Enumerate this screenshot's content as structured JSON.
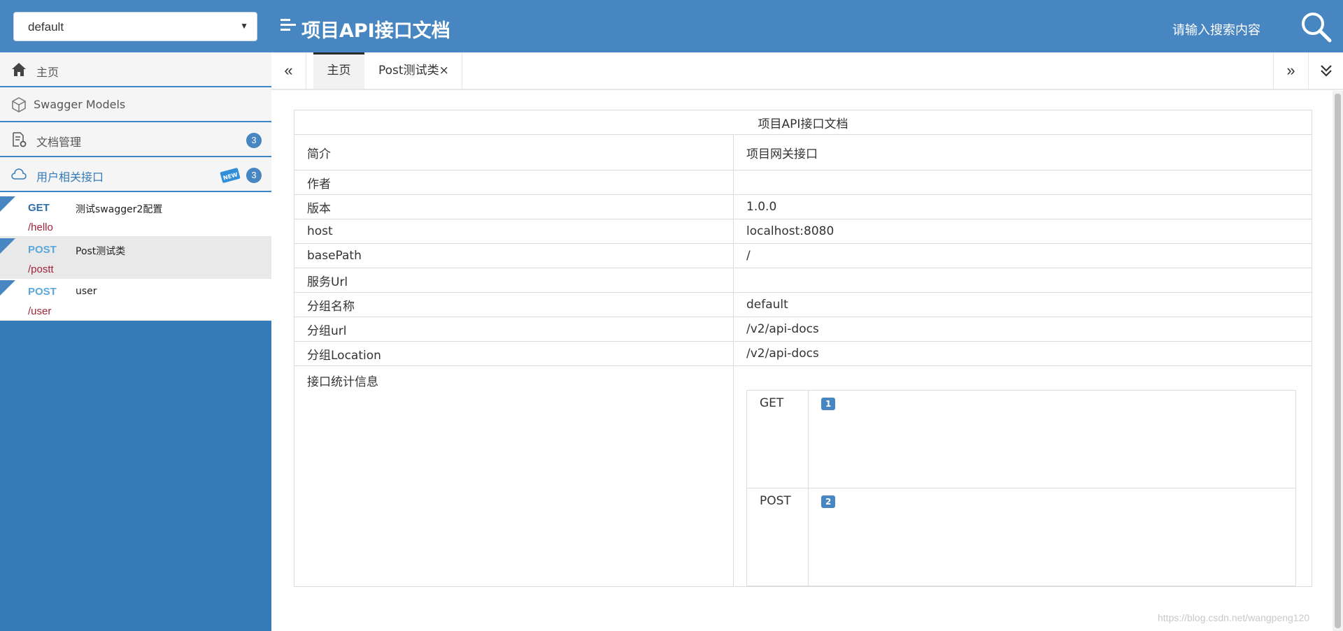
{
  "header": {
    "group_select": "default",
    "title": "项目API接口文档",
    "search_placeholder": "请输入搜索内容"
  },
  "sidebar": {
    "menu": [
      {
        "label": "主页",
        "icon": "home-icon"
      },
      {
        "label": "Swagger Models",
        "icon": "cube-icon"
      },
      {
        "label": "文档管理",
        "icon": "document-settings-icon",
        "badge": "3"
      },
      {
        "label": "用户相关接口",
        "icon": "cloud-api-icon",
        "badge": "3",
        "new": "NEW"
      }
    ],
    "apis": [
      {
        "method": "GET",
        "summary": "测试swagger2配置",
        "path": "/hello"
      },
      {
        "method": "POST",
        "summary": "Post测试类",
        "path": "/postt"
      },
      {
        "method": "POST",
        "summary": "user",
        "path": "/user"
      }
    ]
  },
  "tabs": {
    "prev": "«",
    "next": "»",
    "items": [
      {
        "label": "主页"
      },
      {
        "label": "Post测试类×"
      }
    ]
  },
  "doc": {
    "title": "项目API接口文档",
    "rows": [
      {
        "key": "简介",
        "value": "项目网关接口"
      },
      {
        "key": "作者",
        "value": ""
      },
      {
        "key": "版本",
        "value": "1.0.0"
      },
      {
        "key": "host",
        "value": "localhost:8080"
      },
      {
        "key": "basePath",
        "value": "/"
      },
      {
        "key": "服务Url",
        "value": ""
      },
      {
        "key": "分组名称",
        "value": "default"
      },
      {
        "key": "分组url",
        "value": "/v2/api-docs"
      },
      {
        "key": "分组Location",
        "value": "/v2/api-docs"
      }
    ],
    "stats_label": "接口统计信息",
    "stats": [
      {
        "method": "GET",
        "count": "1"
      },
      {
        "method": "POST",
        "count": "2"
      }
    ]
  },
  "watermark": "https://blog.csdn.net/wangpeng120",
  "colors": {
    "header_bg": "#4786c0",
    "sidebar_bg": "#337ab7",
    "path_color": "#a0243a",
    "badge_bg": "#4786c0"
  }
}
